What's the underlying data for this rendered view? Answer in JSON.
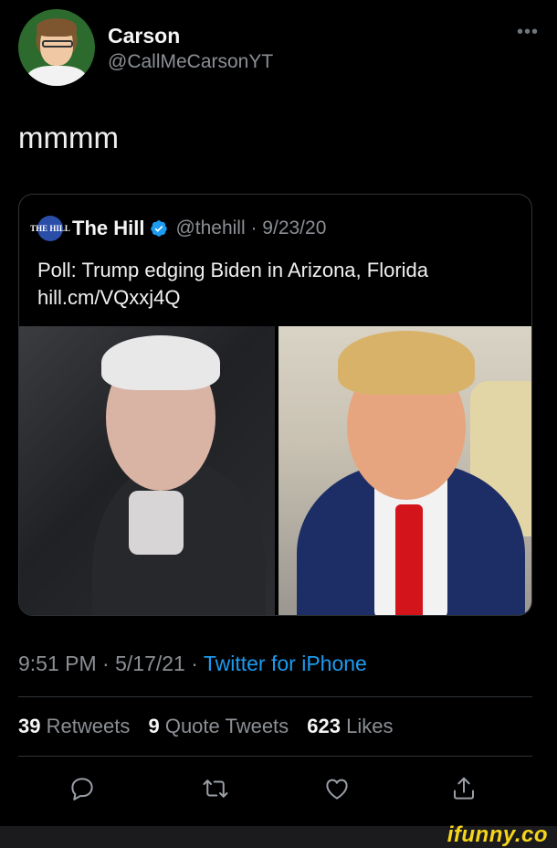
{
  "author": {
    "display_name": "Carson",
    "handle": "@CallMeCarsonYT",
    "more_label": "•••"
  },
  "tweet": {
    "text": "mmmm"
  },
  "quoted_tweet": {
    "logo_text": "THE HILL",
    "name": "The Hill",
    "handle_date": "@thehill · 9/23/20",
    "headline": "Poll: Trump edging Biden in Arizona, Florida",
    "link": "hill.cm/VQxxj4Q"
  },
  "meta": {
    "time_date": "9:51 PM · 5/17/21 · ",
    "source": "Twitter for iPhone"
  },
  "stats": {
    "retweets_count": "39",
    "retweets_label": "Retweets",
    "quote_count": "9",
    "quote_label": "Quote Tweets",
    "likes_count": "623",
    "likes_label": "Likes"
  },
  "actions": {
    "reply": "reply-icon",
    "retweet": "retweet-icon",
    "like": "heart-icon",
    "share": "share-icon"
  },
  "watermark": "ifunny.co",
  "colors": {
    "background": "#000000",
    "link": "#1d9bf0",
    "secondary_text": "#8b8f94",
    "verified": "#1d9bf0",
    "watermark": "#f6d51a"
  }
}
